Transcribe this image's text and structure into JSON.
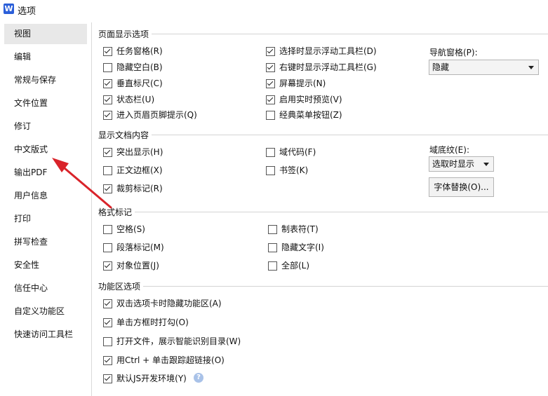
{
  "window": {
    "title": "选项",
    "logo_letter": "W"
  },
  "sidebar": {
    "items": [
      {
        "label": "视图"
      },
      {
        "label": "编辑"
      },
      {
        "label": "常规与保存"
      },
      {
        "label": "文件位置"
      },
      {
        "label": "修订"
      },
      {
        "label": "中文版式"
      },
      {
        "label": "输出PDF"
      },
      {
        "label": "用户信息"
      },
      {
        "label": "打印"
      },
      {
        "label": "拼写检查"
      },
      {
        "label": "安全性"
      },
      {
        "label": "信任中心"
      },
      {
        "label": "自定义功能区"
      },
      {
        "label": "快速访问工具栏"
      }
    ],
    "selected": "视图"
  },
  "page_display": {
    "title": "页面显示选项",
    "left_options": [
      {
        "label": "任务窗格(R)",
        "checked": true
      },
      {
        "label": "隐藏空白(B)",
        "checked": false
      },
      {
        "label": "垂直标尺(C)",
        "checked": true
      },
      {
        "label": "状态栏(U)",
        "checked": true
      },
      {
        "label": "进入页眉页脚提示(Q)",
        "checked": true
      }
    ],
    "right_options": [
      {
        "label": "选择时显示浮动工具栏(D)",
        "checked": true
      },
      {
        "label": "右键时显示浮动工具栏(G)",
        "checked": true
      },
      {
        "label": "屏幕提示(N)",
        "checked": true
      },
      {
        "label": "启用实时预览(V)",
        "checked": true
      },
      {
        "label": "经典菜单按钮(Z)",
        "checked": false
      }
    ],
    "nav_pane_label": "导航窗格(P):",
    "nav_pane_value": "隐藏"
  },
  "doc_content": {
    "title": "显示文档内容",
    "left_options": [
      {
        "label": "突出显示(H)",
        "checked": true
      },
      {
        "label": "正文边框(X)",
        "checked": false
      },
      {
        "label": "裁剪标记(R)",
        "checked": true
      }
    ],
    "right_options": [
      {
        "label": "域代码(F)",
        "checked": false
      },
      {
        "label": "书签(K)",
        "checked": false
      }
    ],
    "field_shading_label": "域底纹(E):",
    "field_shading_value": "选取时显示",
    "font_replace_button": "字体替换(O)..."
  },
  "format_marks": {
    "title": "格式标记",
    "left_options": [
      {
        "label": "空格(S)",
        "checked": false
      },
      {
        "label": "段落标记(M)",
        "checked": false
      },
      {
        "label": "对象位置(J)",
        "checked": true
      }
    ],
    "right_options": [
      {
        "label": "制表符(T)",
        "checked": false
      },
      {
        "label": "隐藏文字(I)",
        "checked": false
      },
      {
        "label": "全部(L)",
        "checked": false
      }
    ]
  },
  "ribbon": {
    "title": "功能区选项",
    "options": [
      {
        "label": "双击选项卡时隐藏功能区(A)",
        "checked": true
      },
      {
        "label": "单击方框时打勾(O)",
        "checked": true
      },
      {
        "label": "打开文件，展示智能识别目录(W)",
        "checked": false
      },
      {
        "label": "用Ctrl + 单击跟踪超链接(O)",
        "checked": true
      },
      {
        "label": "默认JS开发环境(Y)",
        "checked": true
      }
    ],
    "help_glyph": "?"
  },
  "annotation": {
    "arrow_color": "#d9232a"
  }
}
